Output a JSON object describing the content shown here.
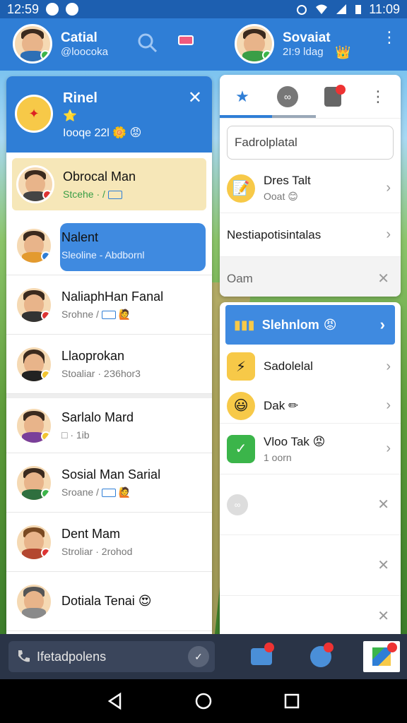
{
  "status_bar": {
    "time": "12:59",
    "right_time": "11:09"
  },
  "appbar": {
    "left_account": {
      "name": "Catial",
      "handle": "@loocoka"
    },
    "right_account": {
      "name": "Sovaiat",
      "sub": "2I:9 ldag"
    }
  },
  "left_panel": {
    "header": {
      "title": "Rinel",
      "sub": "Iooqe 22l"
    },
    "chats": [
      {
        "title": "Obrocal Man",
        "sub": "Stcehe · /"
      },
      {
        "title": "Nalent",
        "sub": "Sleoline - Abdbornl"
      },
      {
        "title": "NaliaphHan Fanal",
        "sub": "Srohne /"
      },
      {
        "title": "Llaoprokan",
        "sub": "Stoaliar · 2З6hor3"
      },
      {
        "title": "Sarlalo Mard",
        "sub": "□ · 1ib"
      },
      {
        "title": "Sosial Man Sarial",
        "sub": "Sroane /"
      },
      {
        "title": "Dent Mam",
        "sub": "Stroliar · 2rohod"
      },
      {
        "title": "Dotiala Tenai",
        "sub": ""
      }
    ]
  },
  "right_top": {
    "search_placeholder": "Fadrolplatal",
    "rows": [
      {
        "title": "Dres Talt",
        "sub": "Ooat"
      },
      {
        "title": "Nestiapotisintalas",
        "sub": ""
      },
      {
        "title": "Oam",
        "sub": ""
      }
    ]
  },
  "right_bottom": {
    "blue_row_label": "Slehnlom",
    "rows": [
      {
        "title": "Sadolelal"
      },
      {
        "title": "Dak"
      },
      {
        "title": "Vloo Tak",
        "sub": "1 oorn"
      }
    ]
  },
  "bottom_bar": {
    "search_text": "Ifetadpolens"
  },
  "colors": {
    "primary": "#2f7ed6",
    "accent_blue": "#3f8ae0",
    "highlight_yellow": "#f6e7b8"
  }
}
